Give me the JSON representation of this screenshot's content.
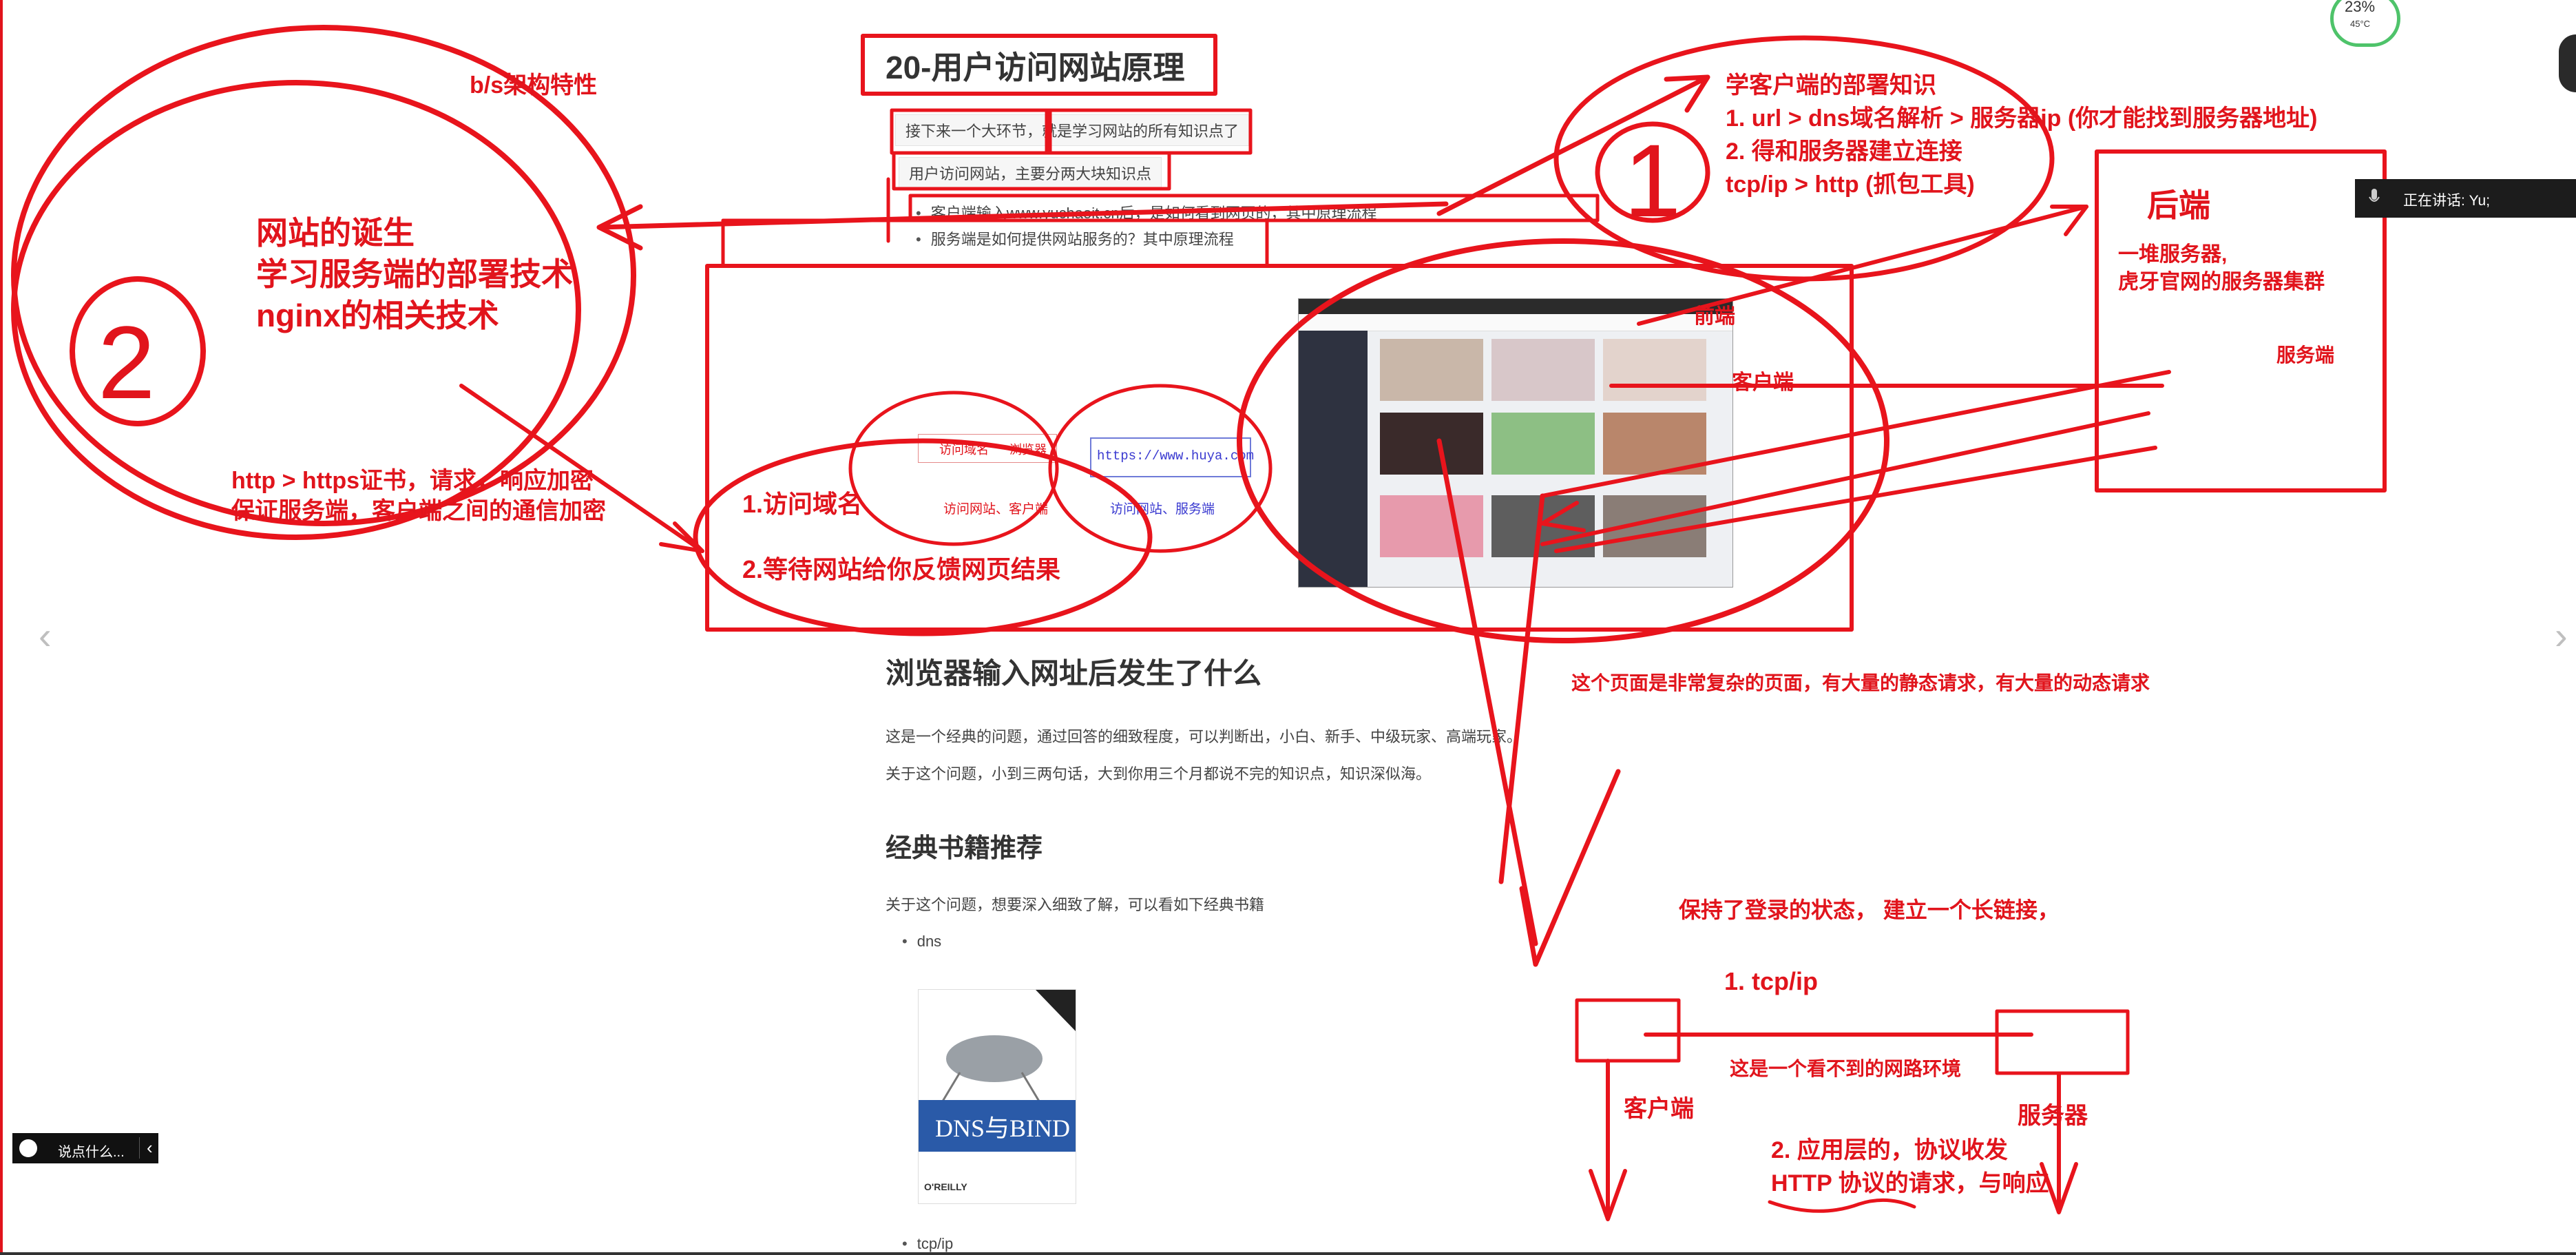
{
  "document": {
    "title": "20-用户访问网站原理",
    "intro": "接下来一个大环节，就是学习网站的所有知识点了",
    "points_intro": "用户访问网站，主要分两大块知识点",
    "bullets": [
      "客户端输入www.yuchaoit.cn后，是如何看到网页的，其中原理流程",
      "服务端是如何提供网站服务的？其中原理流程"
    ],
    "diagram": {
      "browser_label": "浏览器",
      "browser_prefix": "访问域名",
      "url_text": "https://www.huya.com",
      "caption_client": "访问网站、客户端",
      "caption_server": "访问网站、服务端"
    },
    "section_title": "浏览器输入网址后发生了什么",
    "para1": "这是一个经典的问题，通过回答的细致程度，可以判断出，小白、新手、中级玩家、高端玩家。",
    "para2": "关于这个问题，小到三两句话，大到你用三个月都说不完的知识点，知识深似海。",
    "books_title": "经典书籍推荐",
    "books_intro": "关于这个问题，想要深入细致了解，可以看如下经典书籍",
    "book_items": [
      "dns",
      "tcp/ip"
    ],
    "book_cover": {
      "title": "DNS与BIND",
      "publisher": "O'REILLY"
    }
  },
  "annotations": {
    "bs_feature": "b/s架构特性",
    "left_block": [
      "网站的诞生",
      "学习服务端的部署技术",
      "nginx的相关技术"
    ],
    "https_note": [
      "http >   https证书，请求，响应加密",
      "保证服务端，客户端之间的通信加密"
    ],
    "step1": "1.访问域名",
    "step2": "2.等待网站给你反馈网页结果",
    "client_deploy": [
      "学客户端的部署知识",
      "1. url > dns域名解析 > 服务器ip (你才能找到服务器地址)",
      "2. 得和服务器建立连接",
      "tcp/ip >  http  (抓包工具)"
    ],
    "frontend": "前端",
    "client": "客户端",
    "backend": "后端",
    "backend_desc": [
      "一堆服务器,",
      "虎牙官网的服务器集群"
    ],
    "server_label": "服务端",
    "complex_page": "这个页面是非常复杂的页面，有大量的静态请求，有大量的动态请求",
    "keep_login": "保持了登录的状态， 建立一个长链接，",
    "tcpip_step": "1.   tcp/ip",
    "invisible_net": "这是一个看不到的网路环境",
    "client2": "客户端",
    "server2": "服务器",
    "app_layer": [
      "2. 应用层的，协议收发",
      "HTTP 协议的请求，与响应"
    ],
    "circle_1": "1",
    "circle_2": "2"
  },
  "ui": {
    "speaking_label": "正在讲话: Yu;",
    "chat_placeholder": "说点什么...",
    "gauge_value": "23%",
    "gauge_temp": "45°C"
  },
  "colors": {
    "ink": "#e8141c",
    "text": "#333333"
  }
}
